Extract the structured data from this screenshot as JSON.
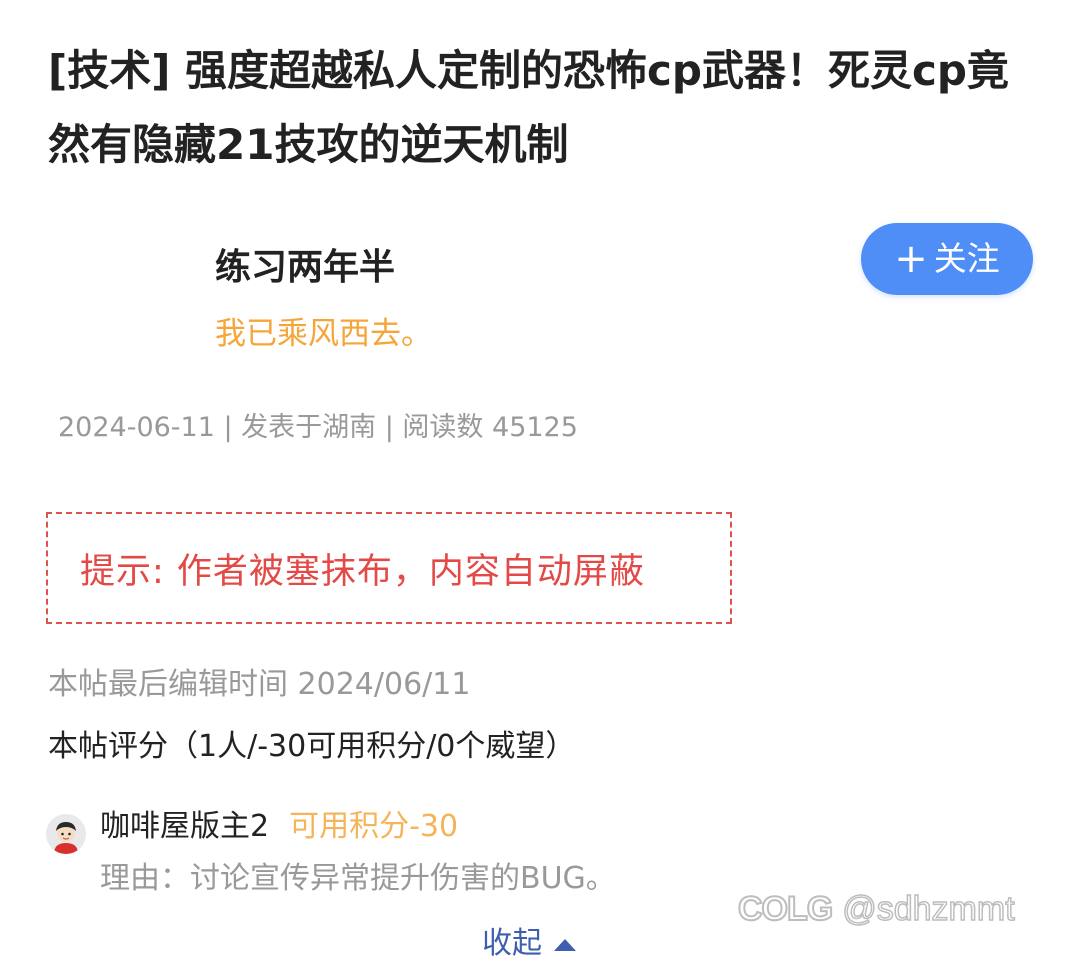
{
  "post": {
    "title": "[技术] 强度超越私人定制的恐怖cp武器！死灵cp竟然有隐藏21技攻的逆天机制"
  },
  "author": {
    "name": "练习两年半",
    "signature": "我已乘风西去。",
    "follow_label": "关注",
    "follow_icon": "plus-icon"
  },
  "meta": {
    "line": "2024-06-11 | 发表于湖南 | 阅读数 45125"
  },
  "notice": {
    "text": "提示: 作者被塞抹布，内容自动屏蔽"
  },
  "edit_info": {
    "last_edit": "本帖最后编辑时间 2024/06/11"
  },
  "rating": {
    "summary": "本帖评分（1人/-30可用积分/0个威望）",
    "entries": [
      {
        "rater": "咖啡屋版主2",
        "score": "可用积分-30",
        "reason": "理由：讨论宣传异常提升伤害的BUG。"
      }
    ],
    "collapse_label": "收起"
  },
  "watermark": {
    "logo": "COLG",
    "handle": "@sdhzmmt"
  },
  "colors": {
    "follow_button": "#4f8ef7",
    "signature": "#f5a53a",
    "notice_red": "#e34a47",
    "score_orange": "#f5b35a",
    "link_blue": "#3d5fae"
  }
}
